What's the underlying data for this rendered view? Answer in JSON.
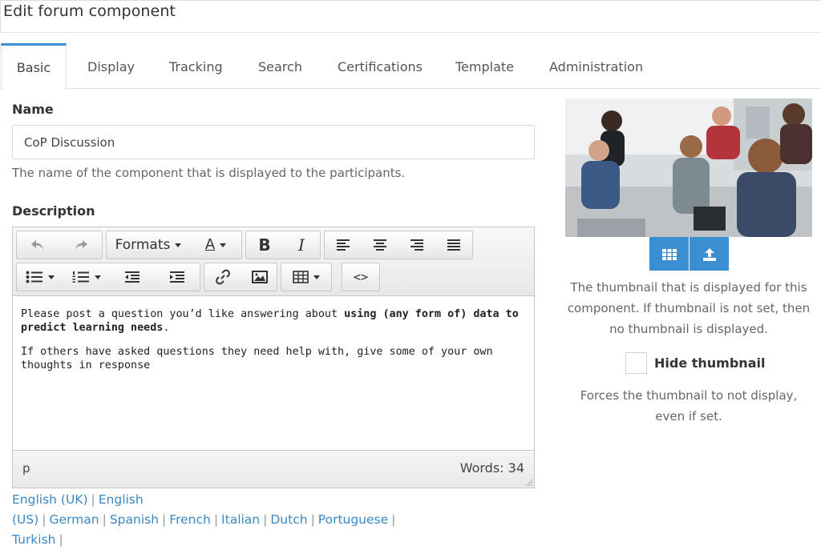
{
  "page": {
    "title": "Edit forum component"
  },
  "tabs": [
    {
      "label": "Basic",
      "active": true
    },
    {
      "label": "Display"
    },
    {
      "label": "Tracking"
    },
    {
      "label": "Search"
    },
    {
      "label": "Certifications"
    },
    {
      "label": "Template"
    },
    {
      "label": "Administration"
    }
  ],
  "name_field": {
    "label": "Name",
    "value": "CoP Discussion",
    "help": "The name of the component that is displayed to the participants."
  },
  "description": {
    "label": "Description",
    "toolbar": {
      "formats_label": "Formats",
      "font_color_glyph": "A",
      "bold_glyph": "B",
      "italic_glyph": "I",
      "code_glyph": "<>",
      "icons": [
        "undo-icon",
        "redo-icon",
        "font-color-icon",
        "bold-icon",
        "italic-icon",
        "align-left-icon",
        "align-center-icon",
        "align-right-icon",
        "align-justify-icon",
        "bullet-list-icon",
        "numbered-list-icon",
        "outdent-icon",
        "indent-icon",
        "link-icon",
        "image-icon",
        "table-icon",
        "source-code-icon"
      ]
    },
    "content": {
      "p1_text": "Please post a question you’d like answering about ",
      "p1_bold": "using (any form of) data to predict learning needs",
      "p1_end": ".",
      "p2": "If others have asked questions they need help with, give some of your own thoughts in response"
    },
    "status": {
      "path": "p",
      "words": "Words: 34"
    }
  },
  "languages": [
    "English (UK)",
    "English (US)",
    "German",
    "Spanish",
    "French",
    "Italian",
    "Dutch",
    "Portuguese",
    "Turkish"
  ],
  "thumbnail": {
    "help": "The thumbnail that is displayed for this component. If thumbnail is not set, then no thumbnail is displayed.",
    "hide_label": "Hide thumbnail",
    "hide_checked": false,
    "hide_help": "Forces the thumbnail to not display, even if set.",
    "icons": [
      "grid-icon",
      "upload-icon"
    ]
  },
  "colors": {
    "accent": "#3a8fd1",
    "link": "#3a88c5"
  }
}
